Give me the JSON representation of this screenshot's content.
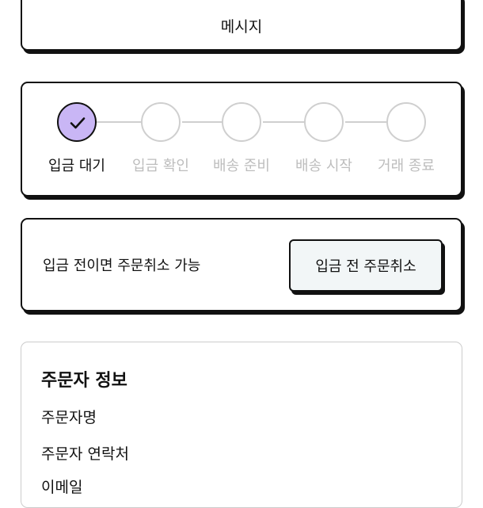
{
  "message": {
    "label": "메시지"
  },
  "progress": {
    "steps": [
      {
        "label": "입금 대기",
        "state": "done"
      },
      {
        "label": "입금 확인",
        "state": "pending"
      },
      {
        "label": "배송 준비",
        "state": "pending"
      },
      {
        "label": "배송 시작",
        "state": "pending"
      },
      {
        "label": "거래 종료",
        "state": "pending"
      }
    ]
  },
  "cancel": {
    "notice": "입금 전이면 주문취소 가능",
    "button_label": "입금 전 주문취소"
  },
  "orderer": {
    "title": "주문자 정보",
    "fields": [
      "주문자명",
      "주문자 연락처",
      "이메일"
    ]
  },
  "colors": {
    "border": "#111111",
    "done_step_fill": "#c9b6f5",
    "pending_step": "#cfcfcf",
    "pending_label": "#bdbdbd",
    "button_bg": "#f2f6f7"
  },
  "icons": {
    "done_step": "check-icon"
  }
}
